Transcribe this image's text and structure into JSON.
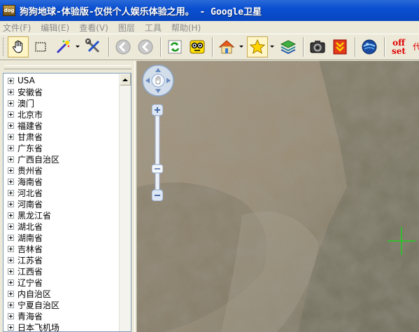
{
  "window": {
    "title": "狗狗地球-体验版-仅供个人娱乐体验之用。 - Google卫星",
    "app_icon_text": "dog"
  },
  "menu": {
    "items": [
      "文件(F)",
      "编辑(E)",
      "查看(V)",
      "图层",
      "工具",
      "帮助(H)"
    ]
  },
  "toolbar": {
    "offset_label_1": "off",
    "offset_label_2": "set",
    "proxy_label": "代理"
  },
  "tree": {
    "items": [
      "USA",
      "安徽省",
      "澳门",
      "北京市",
      "福建省",
      "甘肃省",
      "广东省",
      "广西自治区",
      "贵州省",
      "海南省",
      "河北省",
      "河南省",
      "黑龙江省",
      "湖北省",
      "湖南省",
      "吉林省",
      "江苏省",
      "江西省",
      "辽宁省",
      "内自治区",
      "宁夏自治区",
      "青海省",
      "日本飞机场"
    ]
  },
  "map": {
    "crosshair_color": "#22cc22"
  }
}
